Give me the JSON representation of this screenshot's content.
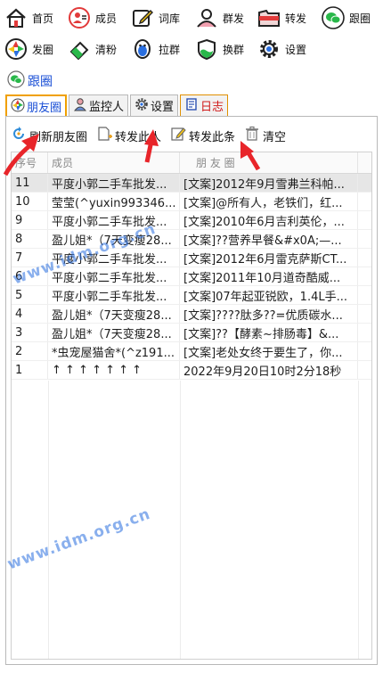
{
  "nav": {
    "items": [
      {
        "label": "首页",
        "icon": "home-icon"
      },
      {
        "label": "成员",
        "icon": "member-card-icon"
      },
      {
        "label": "词库",
        "icon": "pencil-icon"
      },
      {
        "label": "群发",
        "icon": "users-icon"
      },
      {
        "label": "转发",
        "icon": "folder-icon"
      },
      {
        "label": "跟圈",
        "icon": "wechat-icon"
      },
      {
        "label": "发圈",
        "icon": "camera-circle-icon"
      },
      {
        "label": "清粉",
        "icon": "eraser-icon"
      },
      {
        "label": "拉群",
        "icon": "qq-penguin-icon"
      },
      {
        "label": "换群",
        "icon": "shield-icon"
      },
      {
        "label": "设置",
        "icon": "gear-icon"
      }
    ]
  },
  "section": {
    "title": "跟圈",
    "icon": "wechat-icon"
  },
  "tabs": [
    {
      "label": "朋友圈",
      "icon": "moments-icon",
      "active": true
    },
    {
      "label": "监控人",
      "icon": "person-icon",
      "active": false
    },
    {
      "label": "设置",
      "icon": "gear-icon",
      "active": false
    },
    {
      "label": "日志",
      "icon": "log-icon",
      "active": false
    }
  ],
  "toolbar": {
    "refresh_label": "刷新朋友圈",
    "forward_person_label": "转发此人",
    "forward_item_label": "转发此条",
    "clear_label": "清空"
  },
  "grid": {
    "headers": [
      "序号",
      "成员",
      "朋 友 圈",
      ""
    ],
    "rows": [
      {
        "no": "11",
        "member": "平度小郭二手车批发...",
        "moment": "[文案]2012年9月雪弗兰科帕...",
        "selected": true
      },
      {
        "no": "10",
        "member": "莹莹(^yuxin993346...",
        "moment": "[文案]@所有人，老铁们，红..."
      },
      {
        "no": "9",
        "member": "平度小郭二手车批发...",
        "moment": "[文案]2010年6月吉利英伦，..."
      },
      {
        "no": "8",
        "member": "盈儿姐*（7天变瘦28...",
        "moment": "[文案]??营养早餐&#x0A;—..."
      },
      {
        "no": "7",
        "member": "平度小郭二手车批发...",
        "moment": "[文案]2012年6月雷克萨斯CT..."
      },
      {
        "no": "6",
        "member": "平度小郭二手车批发...",
        "moment": "[文案]2011年10月道奇酷威..."
      },
      {
        "no": "5",
        "member": "平度小郭二手车批发...",
        "moment": "[文案]07年起亚锐欧，1.4L手..."
      },
      {
        "no": "4",
        "member": "盈儿姐*（7天变瘦28...",
        "moment": "[文案]????肽多??=优质碳水..."
      },
      {
        "no": "3",
        "member": "盈儿姐*（7天变瘦28...",
        "moment": "[文案]??【酵素~排肠毒】&..."
      },
      {
        "no": "2",
        "member": "*虫宠屋猫舍*(^z191...",
        "moment": "[文案]老处女终于要生了，你..."
      },
      {
        "no": "1",
        "member": "↑ ↑ ↑ ↑ ↑ ↑ ↑",
        "moment": "2022年9月20日10时2分18秒"
      }
    ]
  },
  "watermark": {
    "text": "www.idm.org.cn"
  },
  "colors": {
    "accent": "#1a4fd6",
    "arrow": "#e8252a",
    "tab_border": "#f0a000",
    "log_text": "#d01818",
    "watermark": "#2a6fe0"
  }
}
